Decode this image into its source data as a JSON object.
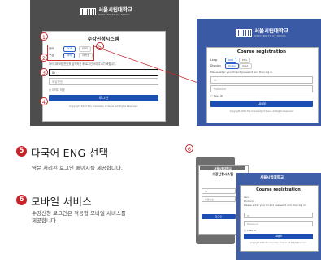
{
  "markers": {
    "m1": "1",
    "m2": "2",
    "m3": "3",
    "m4": "4",
    "m5": "5",
    "m6": "6"
  },
  "kr_login": {
    "university_ko": "서울시립대학교",
    "university_en": "UNIVERSITY OF SEOUL",
    "title": "수강신청시스템",
    "lang_label": "언어",
    "lang_options": [
      "KOR",
      "ENG"
    ],
    "type_label": "구분",
    "type_options": [
      "대학",
      "대학원"
    ],
    "notice": "아이디와 비밀번호를 입력하신 후 로그인하여 주시기 바랍니다.",
    "id_value": "ID",
    "password_placeholder": "비밀번호",
    "save_id": "아이디 저장",
    "login_button": "로그인",
    "copyright": "Copyright 2024 The University of Seoul. All Rights Reserved."
  },
  "en_login": {
    "university_ko": "서울시립대학교",
    "university_en": "UNIVERSITY OF SEOUL",
    "title": "Course registration",
    "lang_label": "Lang.",
    "lang_options": [
      "KOR",
      "ENG"
    ],
    "division_label": "Division",
    "division_options": [
      "Under",
      "Grad."
    ],
    "notice": "Please enter your ID and password and then log in.",
    "id_placeholder": "ID",
    "password_placeholder": "Password",
    "save_id": "Save ID",
    "login_button": "Login",
    "copyright": "Copyright 2024 The University of Seoul. All Rights Reserved."
  },
  "section5": {
    "number": "5",
    "heading": "다국어 ENG 선택",
    "description": "영문 처리된 로그인 페이지를 제공합니다."
  },
  "section6": {
    "number": "6",
    "heading": "모바일 서비스",
    "description_line1": "수강신청 로그인은 적응형 모바일 서비스를",
    "description_line2": "제공합니다."
  },
  "mobile_kr": {
    "university_ko": "서울시립대학교",
    "title": "수강신청시스템",
    "id_value": "ID",
    "password_placeholder": "비밀번호",
    "login_button": "로그인"
  },
  "mobile_en": {
    "university_ko": "서울시립대학교",
    "title": "Course registration",
    "lang_label": "Lang.",
    "division_label": "Division",
    "notice": "Please enter your ID and password and then log in.",
    "id_placeholder": "ID",
    "password_placeholder": "Password",
    "save_id": "Save ID",
    "login_button": "Login",
    "copyright": "Copyright 2024 The University of Seoul. All Rights Reserved."
  },
  "colors": {
    "accent_red": "#c8232a",
    "button_blue": "#1d4eb3",
    "en_bg": "#3a5aa6"
  }
}
